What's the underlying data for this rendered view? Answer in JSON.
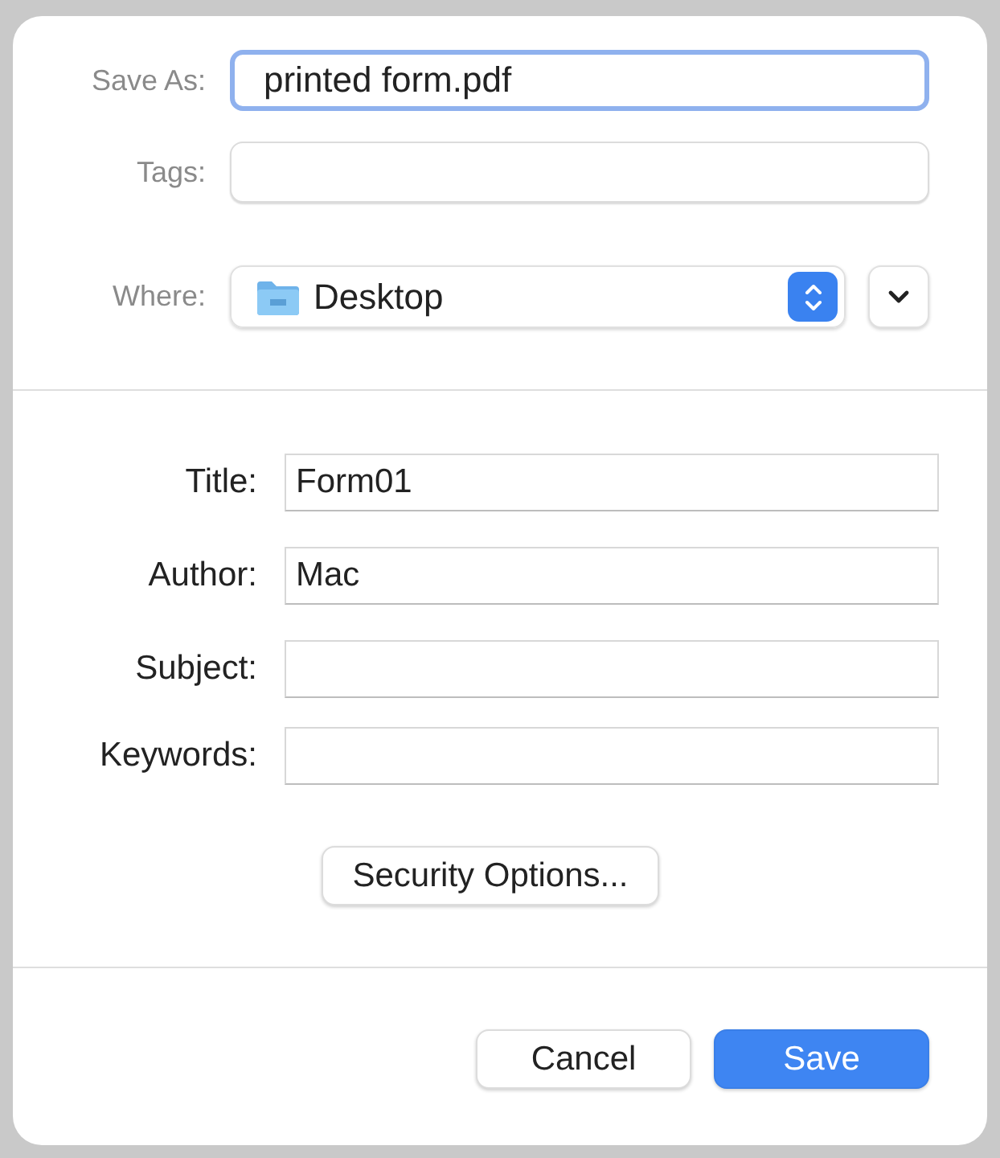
{
  "save_as": {
    "label": "Save As:",
    "value": "printed form.pdf",
    "focused": true
  },
  "tags": {
    "label": "Tags:"
  },
  "where": {
    "label": "Where:",
    "value": "Desktop"
  },
  "metadata": [
    {
      "label": "Title:",
      "value": "Form01"
    },
    {
      "label": "Author:",
      "value": "Mac"
    },
    {
      "label": "Subject:"
    },
    {
      "label": "Keywords:"
    }
  ],
  "security_button": "Security Options...",
  "buttons": [
    {
      "label": "Cancel",
      "kind": "normal"
    },
    {
      "label": "Save",
      "kind": "default"
    }
  ]
}
